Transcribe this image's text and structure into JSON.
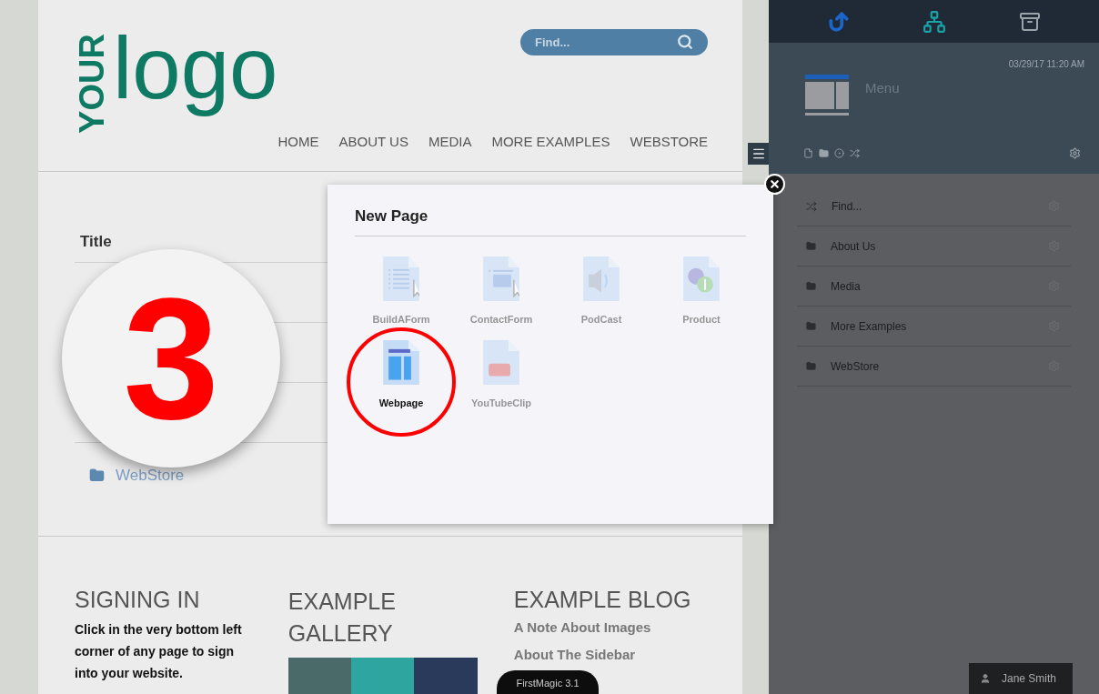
{
  "logo": {
    "word_1": "YOUR",
    "word_2": "logo"
  },
  "search": {
    "placeholder": "Find..."
  },
  "nav": [
    {
      "label": "HOME"
    },
    {
      "label": "ABOUT US"
    },
    {
      "label": "MEDIA"
    },
    {
      "label": "MORE EXAMPLES"
    },
    {
      "label": "WEBSTORE"
    }
  ],
  "content": {
    "title": "Title",
    "rows": [
      {
        "label": "WebStore"
      }
    ]
  },
  "step_badge": "3",
  "footer": {
    "signing_in": {
      "heading": "SIGNING IN",
      "text": "Click in the very bottom left corner of any page to sign into your website."
    },
    "gallery": {
      "heading": "EXAMPLE GALLERY"
    },
    "blog": {
      "heading": "EXAMPLE BLOG",
      "links": [
        "A Note About Images",
        "About The Sidebar"
      ]
    }
  },
  "version_tab": "FirstMagic 3.1",
  "dialog": {
    "title": "New Page",
    "items": [
      {
        "label": "BuildAForm",
        "kind": "form",
        "selected": false
      },
      {
        "label": "ContactForm",
        "kind": "contact",
        "selected": false
      },
      {
        "label": "PodCast",
        "kind": "podcast",
        "selected": false
      },
      {
        "label": "Product",
        "kind": "product",
        "selected": false
      },
      {
        "label": "Webpage",
        "kind": "webpage",
        "selected": true
      },
      {
        "label": "YouTubeClip",
        "kind": "youtube",
        "selected": false
      }
    ]
  },
  "sidebar": {
    "timestamp": "03/29/17 11:20 AM",
    "page_title": "Menu",
    "items": [
      {
        "label": "Find...",
        "kind": "search"
      },
      {
        "label": "About Us",
        "kind": "folder"
      },
      {
        "label": "Media",
        "kind": "folder"
      },
      {
        "label": "More Examples",
        "kind": "folder"
      },
      {
        "label": "WebStore",
        "kind": "folder"
      }
    ]
  },
  "user": {
    "name": "Jane Smith"
  }
}
